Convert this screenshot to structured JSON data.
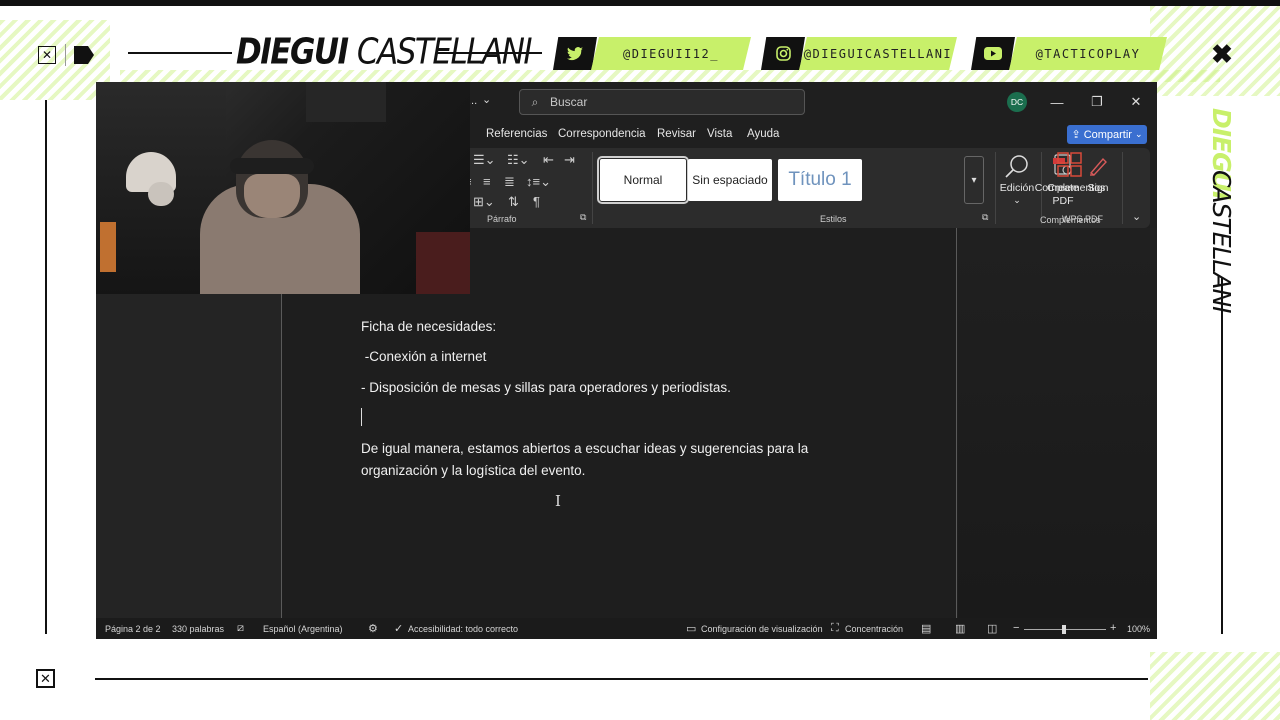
{
  "overlay": {
    "brand_bold": "DIEGUI",
    "brand_thin": "CASTELLANI",
    "side_bold": "DIEGUI",
    "side_thin": "CASTELLANI",
    "socials": [
      {
        "icon": "twitter-icon",
        "handle": "@DIEGUII12_"
      },
      {
        "icon": "instagram-icon",
        "handle": "@DIEGUICASTELLANI"
      },
      {
        "icon": "youtube-icon",
        "handle": "@TACTICOPLAY"
      }
    ],
    "accent": "#c8f06a"
  },
  "word": {
    "title_fragment": "...",
    "search_placeholder": "Buscar",
    "avatar_initials": "DC",
    "menu": [
      "Referencias",
      "Correspondencia",
      "Revisar",
      "Vista",
      "Ayuda"
    ],
    "share_label": "Compartir",
    "ribbon": {
      "paragraph_label": "Párrafo",
      "styles_label": "Estilos",
      "styles": [
        "Normal",
        "Sin espaciado",
        "Título 1"
      ],
      "edit_label": "Edición",
      "create_pdf": "Create PDF",
      "sign": "Sign",
      "wps_label": "WPS PDF",
      "addins_button": "Complementos",
      "addins_label": "Complementos"
    },
    "document": {
      "line1": "Ficha de necesidades:",
      "line2": " -Conexión a internet",
      "line3": "- Disposición de mesas y sillas para operadores y periodistas.",
      "line4": "De igual manera, estamos abiertos a escuchar ideas y sugerencias para la",
      "line5": "organización y la logística del evento."
    },
    "status": {
      "page": "Página 2 de 2",
      "words": "330 palabras",
      "language": "Español (Argentina)",
      "accessibility": "Accesibilidad: todo correcto",
      "display_settings": "Configuración de visualización",
      "focus": "Concentración",
      "zoom": "100%"
    }
  },
  "colors": {
    "word_bg": "#1f1f1f",
    "ribbon_bg": "#2c2c2c",
    "share_btn": "#3a6fd0",
    "avatar": "#1b6e4e"
  }
}
